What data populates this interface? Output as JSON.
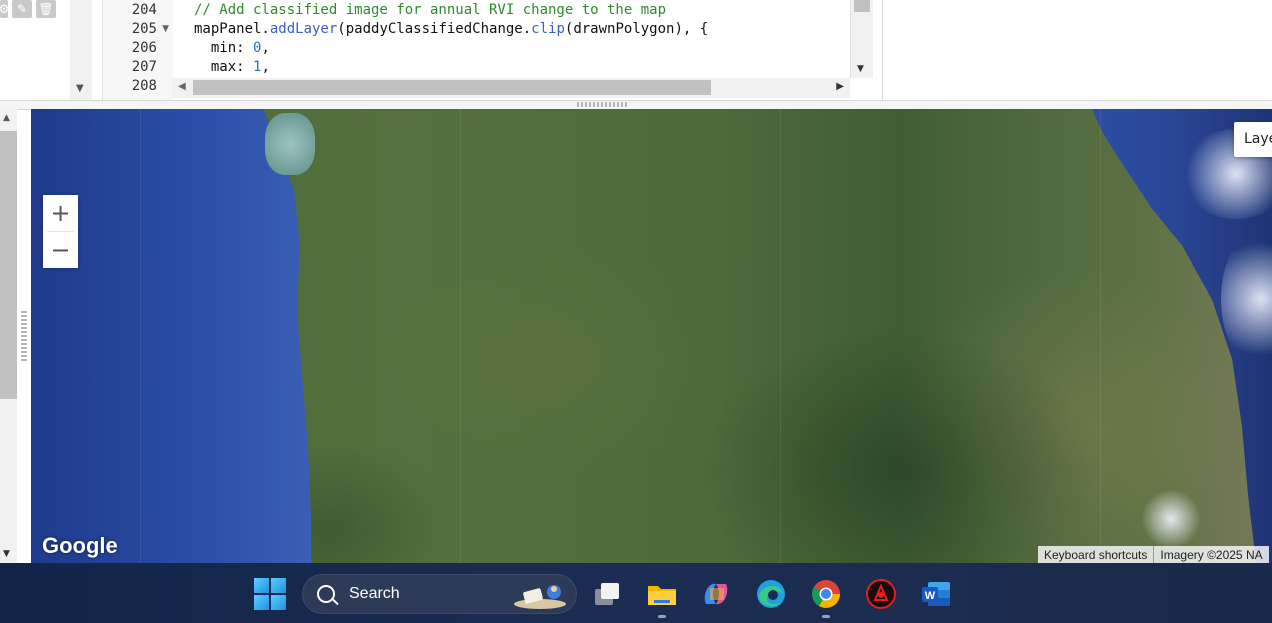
{
  "editor": {
    "lines": [
      {
        "num": "204",
        "fold": false
      },
      {
        "num": "205",
        "fold": true
      },
      {
        "num": "206",
        "fold": false
      },
      {
        "num": "207",
        "fold": false
      },
      {
        "num": "208",
        "fold": false
      }
    ],
    "code": {
      "l204_comment": "// Add classified image for annual RVI change to the map",
      "l205_obj": "mapPanel.",
      "l205_fn": "addLayer",
      "l205_mid": "(paddyClassifiedChange.",
      "l205_fn2": "clip",
      "l205_end": "(drawnPolygon), {",
      "l206_key": "  min: ",
      "l206_val": "0",
      "l206_end": ",",
      "l207_key": "  max: ",
      "l207_val": "1",
      "l207_end": ","
    }
  },
  "map": {
    "zoom_in": "+",
    "zoom_out": "−",
    "layers_label": "Laye",
    "logo": "Google",
    "attribution": {
      "shortcuts": "Keyboard shortcuts",
      "imagery": "Imagery ©2025 NA"
    }
  },
  "taskbar": {
    "search_label": "Search",
    "apps": [
      "task-view",
      "file-explorer",
      "copilot",
      "edge",
      "chrome",
      "app-red",
      "word"
    ]
  },
  "colors": {
    "code_comment": "#2e8b2e",
    "code_function": "#3b5fc6",
    "code_number": "#2a6bd6",
    "taskbar_bg": "#1a2a4c"
  }
}
